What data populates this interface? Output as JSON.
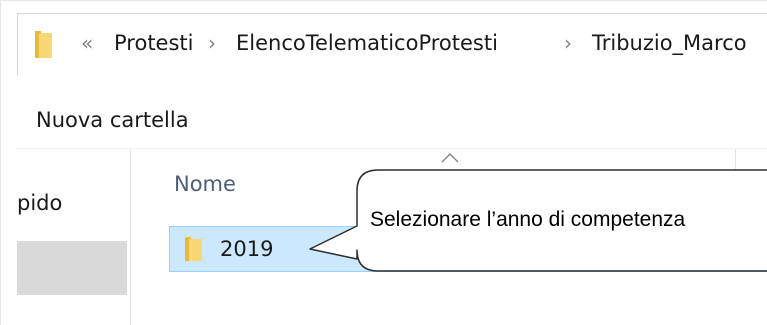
{
  "address_bar": {
    "overflow": "«",
    "crumbs": [
      "Protesti",
      "ElencoTelematicoProtesti",
      "Tribuzio_Marco"
    ]
  },
  "toolbar": {
    "new_folder_label": "Nuova cartella"
  },
  "nav_pane": {
    "item_partial": "pido"
  },
  "file_list": {
    "column_name": "Nome",
    "rows": [
      {
        "name": "2019",
        "type": "folder",
        "selected": true
      }
    ]
  },
  "callout": {
    "text": "Selezionare l’anno di competenza"
  },
  "colors": {
    "selection_fill": "#cce8ff",
    "selection_border": "#99d1ff",
    "folder_yellow": "#f8d775",
    "column_header_text": "#4c607a"
  }
}
